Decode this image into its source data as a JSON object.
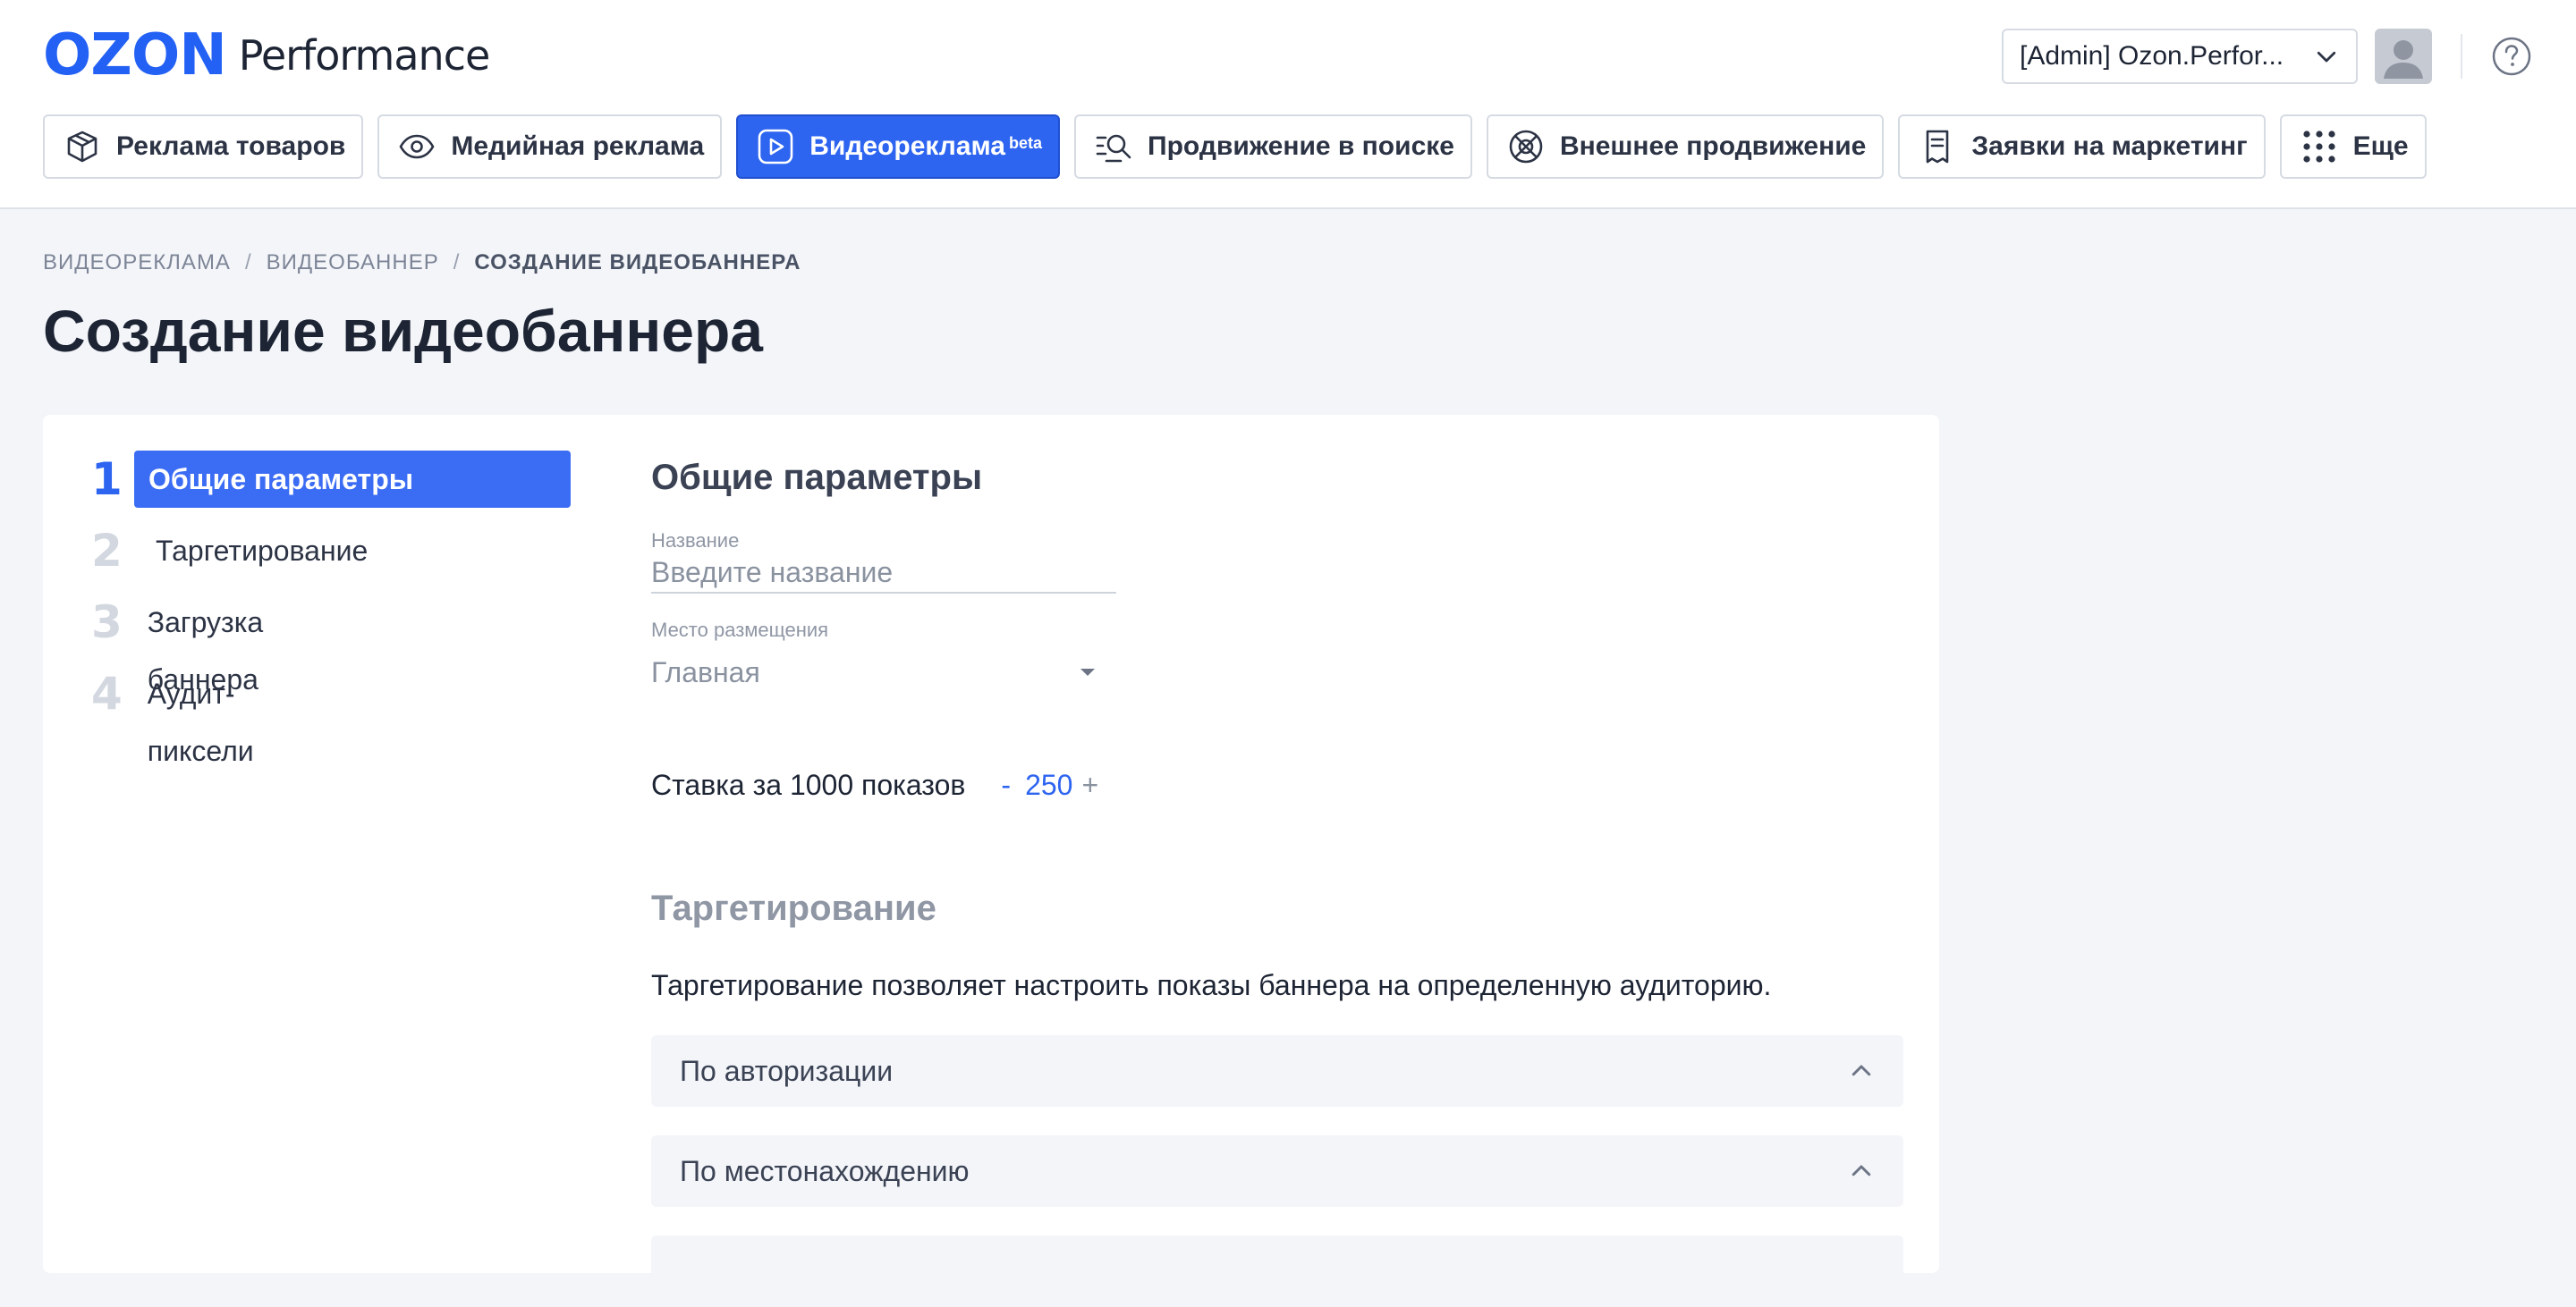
{
  "header": {
    "logo_brand": "OZON",
    "logo_product": "Performance",
    "account_name": "[Admin] Ozon.Perfor...",
    "help_icon": "question-circle-icon",
    "nav": [
      {
        "label": "Реклама товаров",
        "icon": "box-icon",
        "active": false
      },
      {
        "label": "Медийная реклама",
        "icon": "eye-icon",
        "active": false
      },
      {
        "label": "Видеореклама",
        "badge": "beta",
        "icon": "play-icon",
        "active": true
      },
      {
        "label": "Продвижение в поиске",
        "icon": "search-list-icon",
        "active": false
      },
      {
        "label": "Внешнее продвижение",
        "icon": "crossed-circle-icon",
        "active": false
      },
      {
        "label": "Заявки на маркетинг",
        "icon": "receipt-icon",
        "active": false
      },
      {
        "label": "Еще",
        "icon": "grid-dots-icon",
        "active": false
      }
    ]
  },
  "breadcrumb": {
    "items": [
      "ВИДЕОРЕКЛАМА",
      "ВИДЕОБАННЕР",
      "СОЗДАНИЕ ВИДЕОБАННЕРА"
    ],
    "separator": "/"
  },
  "page_title": "Создание видеобаннера",
  "steps": [
    {
      "num": "1",
      "label": "Общие параметры",
      "active": true
    },
    {
      "num": "2",
      "label": "Таргетирование",
      "active": false
    },
    {
      "num": "3",
      "label": "Загрузка баннера",
      "active": false
    },
    {
      "num": "4",
      "label": "Аудит-пиксели",
      "active": false
    }
  ],
  "general": {
    "title": "Общие параметры",
    "name_label": "Название",
    "name_placeholder": "Введите название",
    "name_value": "",
    "placement_label": "Место размещения",
    "placement_value": "Главная",
    "bid_label": "Ставка за 1000 показов",
    "bid_minus": "-",
    "bid_value": "250",
    "bid_plus": "+"
  },
  "targeting": {
    "title": "Таргетирование",
    "description": "Таргетирование позволяет настроить показы баннера на определенную аудиторию.",
    "sections": [
      {
        "label": "По авторизации",
        "expanded": true
      },
      {
        "label": "По местонахождению",
        "expanded": true
      }
    ]
  },
  "colors": {
    "accent": "#2d64f0",
    "brand": "#2361f5",
    "page_bg": "#f3f5f9"
  }
}
